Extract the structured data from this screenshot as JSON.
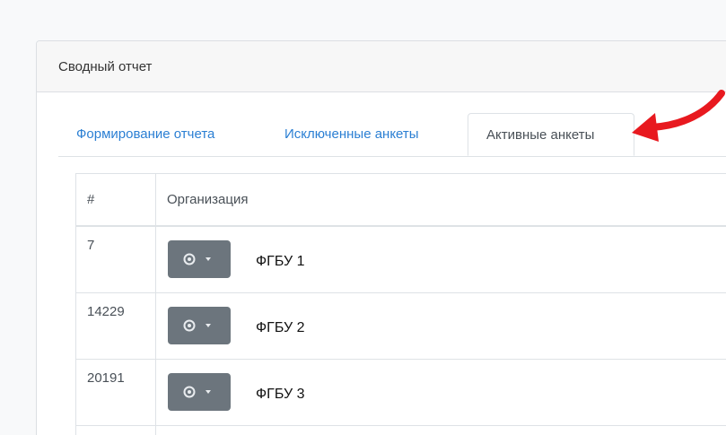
{
  "card": {
    "title": "Сводный отчет"
  },
  "tabs": [
    {
      "label": "Формирование отчета",
      "active": false
    },
    {
      "label": "Исключенные анкеты",
      "active": false
    },
    {
      "label": "Активные анкеты",
      "active": true
    }
  ],
  "table": {
    "columns": [
      "#",
      "Организация"
    ],
    "rows": [
      {
        "id": "7",
        "organization": "ФГБУ 1"
      },
      {
        "id": "14229",
        "organization": "ФГБУ 2"
      },
      {
        "id": "20191",
        "organization": "ФГБУ 3"
      }
    ]
  },
  "icons": {
    "row_action": "gear-icon",
    "dropdown": "caret-down-icon",
    "annotation": "red-arrow-icon"
  },
  "colors": {
    "link": "#2b7fd3",
    "button": "#6c757d",
    "arrow": "#e8191f"
  }
}
